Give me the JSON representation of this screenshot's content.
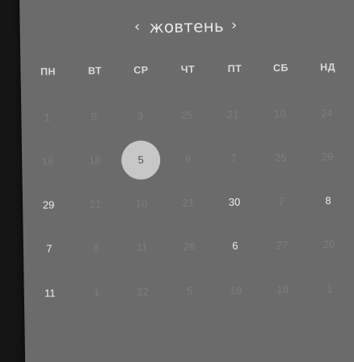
{
  "header": {
    "prev_label": "‹",
    "month": "жовтень",
    "next_label": "›"
  },
  "weekdays": [
    "ПН",
    "ВТ",
    "СР",
    "ЧТ",
    "ПТ",
    "СБ",
    "НД"
  ],
  "weeks": [
    [
      {
        "label": "1",
        "state": "muted"
      },
      {
        "label": "5",
        "state": "muted"
      },
      {
        "label": "3",
        "state": "muted"
      },
      {
        "label": "25",
        "state": "muted"
      },
      {
        "label": "21",
        "state": "muted"
      },
      {
        "label": "10",
        "state": "muted"
      },
      {
        "label": "24",
        "state": "muted"
      }
    ],
    [
      {
        "label": "16",
        "state": "muted"
      },
      {
        "label": "18",
        "state": "muted"
      },
      {
        "label": "5",
        "state": "selected"
      },
      {
        "label": "9",
        "state": "muted"
      },
      {
        "label": "7",
        "state": "muted"
      },
      {
        "label": "25",
        "state": "muted"
      },
      {
        "label": "29",
        "state": "muted"
      }
    ],
    [
      {
        "label": "29",
        "state": "bright"
      },
      {
        "label": "21",
        "state": "muted"
      },
      {
        "label": "10",
        "state": "muted"
      },
      {
        "label": "21",
        "state": "muted"
      },
      {
        "label": "30",
        "state": "bright"
      },
      {
        "label": "7",
        "state": "muted"
      },
      {
        "label": "8",
        "state": "bright"
      }
    ],
    [
      {
        "label": "7",
        "state": "bright"
      },
      {
        "label": "8",
        "state": "muted"
      },
      {
        "label": "11",
        "state": "muted"
      },
      {
        "label": "28",
        "state": "muted"
      },
      {
        "label": "6",
        "state": "bright"
      },
      {
        "label": "27",
        "state": "muted"
      },
      {
        "label": "20",
        "state": "muted"
      }
    ],
    [
      {
        "label": "11",
        "state": "bright"
      },
      {
        "label": "1",
        "state": "muted"
      },
      {
        "label": "22",
        "state": "muted"
      },
      {
        "label": "5",
        "state": "muted"
      },
      {
        "label": "18",
        "state": "muted"
      },
      {
        "label": "18",
        "state": "muted"
      },
      {
        "label": "1",
        "state": "muted"
      }
    ]
  ],
  "colors": {
    "background": "#141414",
    "panel": "#6b6b6b",
    "selected_circle": "#c7c7c7",
    "bright_text": "#ededed",
    "muted_text": "#7d7d7d"
  }
}
